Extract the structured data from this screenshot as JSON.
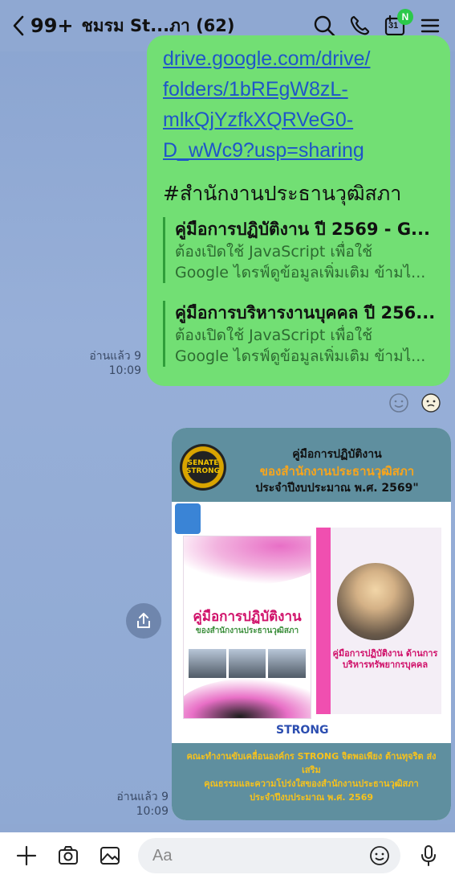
{
  "header": {
    "back_label": "99+",
    "title": "ชมรม St...ภา (62)",
    "calendar_day": "31",
    "calendar_badge": "N"
  },
  "message": {
    "link_lines": [
      "drive.google.com/drive/",
      "folders/1bREgW8zL-",
      "mlkQjYzfkXQRVeG0-",
      "D_wWc9?usp=sharing"
    ],
    "hashtag": "#สำนักงานประธานวุฒิสภา",
    "previews": [
      {
        "title": "คู่มือการปฏิบัติงาน ปี 2569 - G...",
        "desc1": "ต้องเปิดใช้ JavaScript เพื่อใช้",
        "desc2": "Google ไดรฟ์ดูข้อมูลเพิ่มเติม ข้ามไ..."
      },
      {
        "title": "คู่มือการบริหารงานบุคคล ปี 256...",
        "desc1": "ต้องเปิดใช้ JavaScript เพื่อใช้",
        "desc2": "Google ไดรฟ์ดูข้อมูลเพิ่มเติม ข้ามไ..."
      }
    ],
    "read_label": "อ่านแล้ว 9",
    "time": "10:09"
  },
  "image_message": {
    "header_line1": "คู่มือการปฏิบัติงาน",
    "header_line2": "ของสำนักงานประธานวุฒิสภา",
    "header_line3": "ประจำปีงบประมาณ พ.ศ. 2569\"",
    "logo_text": "SENATE STRONG",
    "book1_title": "คู่มือการปฏิบัติงาน",
    "book1_sub": "ของสำนักงานประธานวุฒิสภา",
    "book2_title": "คู่มือการปฏิบัติงาน ด้านการบริหารทรัพยากรบุคคล",
    "strong_label": "STRONG",
    "footer_line1": "คณะทำงานขับเคลื่อนองค์กร STRONG จิตพอเพียง ต้านทุจริต ส่งเสริม",
    "footer_line2": "คุณธรรมและความโปร่งใสของสำนักงานประธานวุฒิสภา",
    "footer_line3": "ประจำปีงบประมาณ พ.ศ. 2569",
    "read_label": "อ่านแล้ว 9",
    "time": "10:09"
  },
  "input": {
    "placeholder": "Aa"
  },
  "colors": {
    "bubble": "#72df74",
    "link": "#1f55c9",
    "chat_bg": "#8fa8d2",
    "badge": "#2bc94a"
  }
}
